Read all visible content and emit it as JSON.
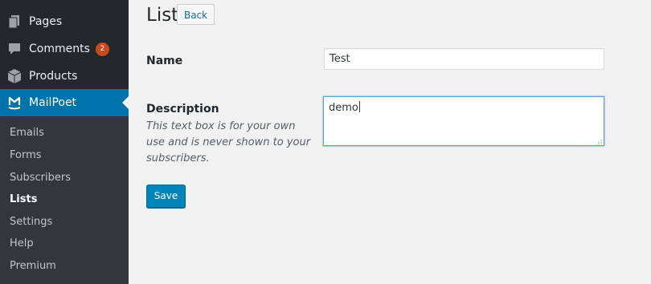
{
  "sidebar": {
    "menu": [
      {
        "label": "Pages",
        "icon": "pages-icon"
      },
      {
        "label": "Comments",
        "icon": "comments-icon",
        "badge": "2"
      },
      {
        "label": "Products",
        "icon": "products-icon"
      },
      {
        "label": "MailPoet",
        "icon": "mailpoet-icon",
        "active": true
      }
    ],
    "submenu": [
      {
        "label": "Emails"
      },
      {
        "label": "Forms"
      },
      {
        "label": "Subscribers"
      },
      {
        "label": "Lists",
        "current": true
      },
      {
        "label": "Settings"
      },
      {
        "label": "Help"
      },
      {
        "label": "Premium"
      }
    ]
  },
  "page": {
    "title": "List",
    "back_label": "Back"
  },
  "form": {
    "name_label": "Name",
    "name_value": "Test",
    "description_label": "Description",
    "description_help": "This text box is for your own use and is never shown to your subscribers.",
    "description_value": "demo",
    "save_label": "Save"
  },
  "colors": {
    "sidebar_bg": "#23282d",
    "submenu_bg": "#32373c",
    "accent": "#0073aa",
    "button_primary": "#0085ba",
    "badge": "#ca4a1f",
    "page_bg": "#f1f1f1"
  }
}
